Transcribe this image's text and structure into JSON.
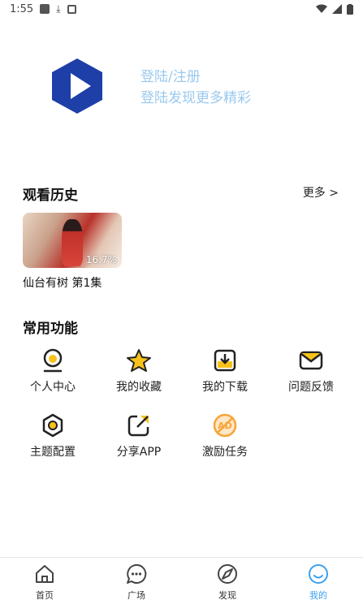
{
  "status_bar": {
    "time": "1:55"
  },
  "profile": {
    "login_label": "登陆/注册",
    "login_subtitle": "登陆发现更多精彩"
  },
  "history": {
    "title": "观看历史",
    "more_label": "更多 >",
    "items": [
      {
        "title": "仙台有树 第1集",
        "progress": "16.7%"
      }
    ]
  },
  "functions": {
    "title": "常用功能",
    "items": [
      {
        "label": "个人中心",
        "icon": "user-center-icon"
      },
      {
        "label": "我的收藏",
        "icon": "star-icon"
      },
      {
        "label": "我的下载",
        "icon": "download-icon"
      },
      {
        "label": "问题反馈",
        "icon": "mail-icon"
      },
      {
        "label": "主题配置",
        "icon": "theme-icon"
      },
      {
        "label": "分享APP",
        "icon": "share-icon"
      },
      {
        "label": "激励任务",
        "icon": "ad-task-icon"
      }
    ]
  },
  "tabs": [
    {
      "label": "首页",
      "icon": "home-icon"
    },
    {
      "label": "广场",
      "icon": "chat-icon"
    },
    {
      "label": "发现",
      "icon": "compass-icon"
    },
    {
      "label": "我的",
      "icon": "smile-icon",
      "active": true
    }
  ],
  "colors": {
    "accent": "#3aa0f0",
    "yellow": "#f8c21a",
    "logo_blue": "#1e3fa8",
    "orange": "#f7a53a"
  }
}
